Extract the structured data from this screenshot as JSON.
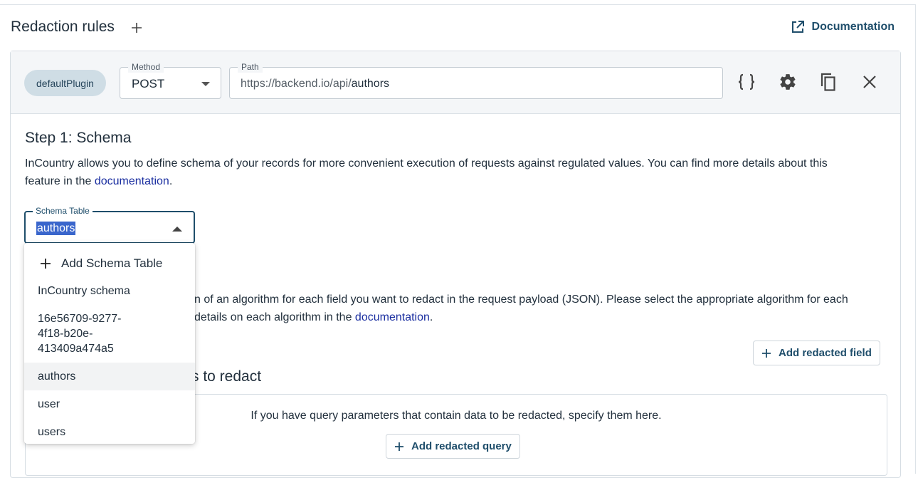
{
  "header": {
    "title": "Redaction rules",
    "documentation_label": "Documentation"
  },
  "rule": {
    "plugin": "defaultPlugin",
    "method_label": "Method",
    "method_value": "POST",
    "path_label": "Path",
    "path_base": "https://backend.io/api/",
    "path_route": "authors"
  },
  "step1": {
    "title": "Step 1: Schema",
    "desc_line1": "InCountry allows you to define schema of your records for more convenient execution of requests against regulated values. You can find more details about this",
    "desc_line2_prefix": "feature in the ",
    "desc_link": "documentation",
    "desc_period": ".",
    "schema_label": "Schema Table",
    "schema_value": "authors"
  },
  "dropdown": {
    "add_label": "Add Schema Table",
    "options": [
      "InCountry schema",
      "16e56709-9277-4f18-b20e-413409a474a5",
      "authors",
      "user",
      "users"
    ]
  },
  "step2": {
    "desc_line1_visible": "n of an algorithm for each field you want to redact in the request payload (JSON). Please select the appropriate algorithm for each",
    "desc_line2_visible": "details on each algorithm in the ",
    "desc_link": "documentation",
    "desc_period": ".",
    "add_field_label": "Add redacted field"
  },
  "query": {
    "title_visible": "s to redact",
    "hint": "If you have query parameters that contain data to be redacted, specify them here.",
    "add_query_label": "Add redacted query"
  }
}
